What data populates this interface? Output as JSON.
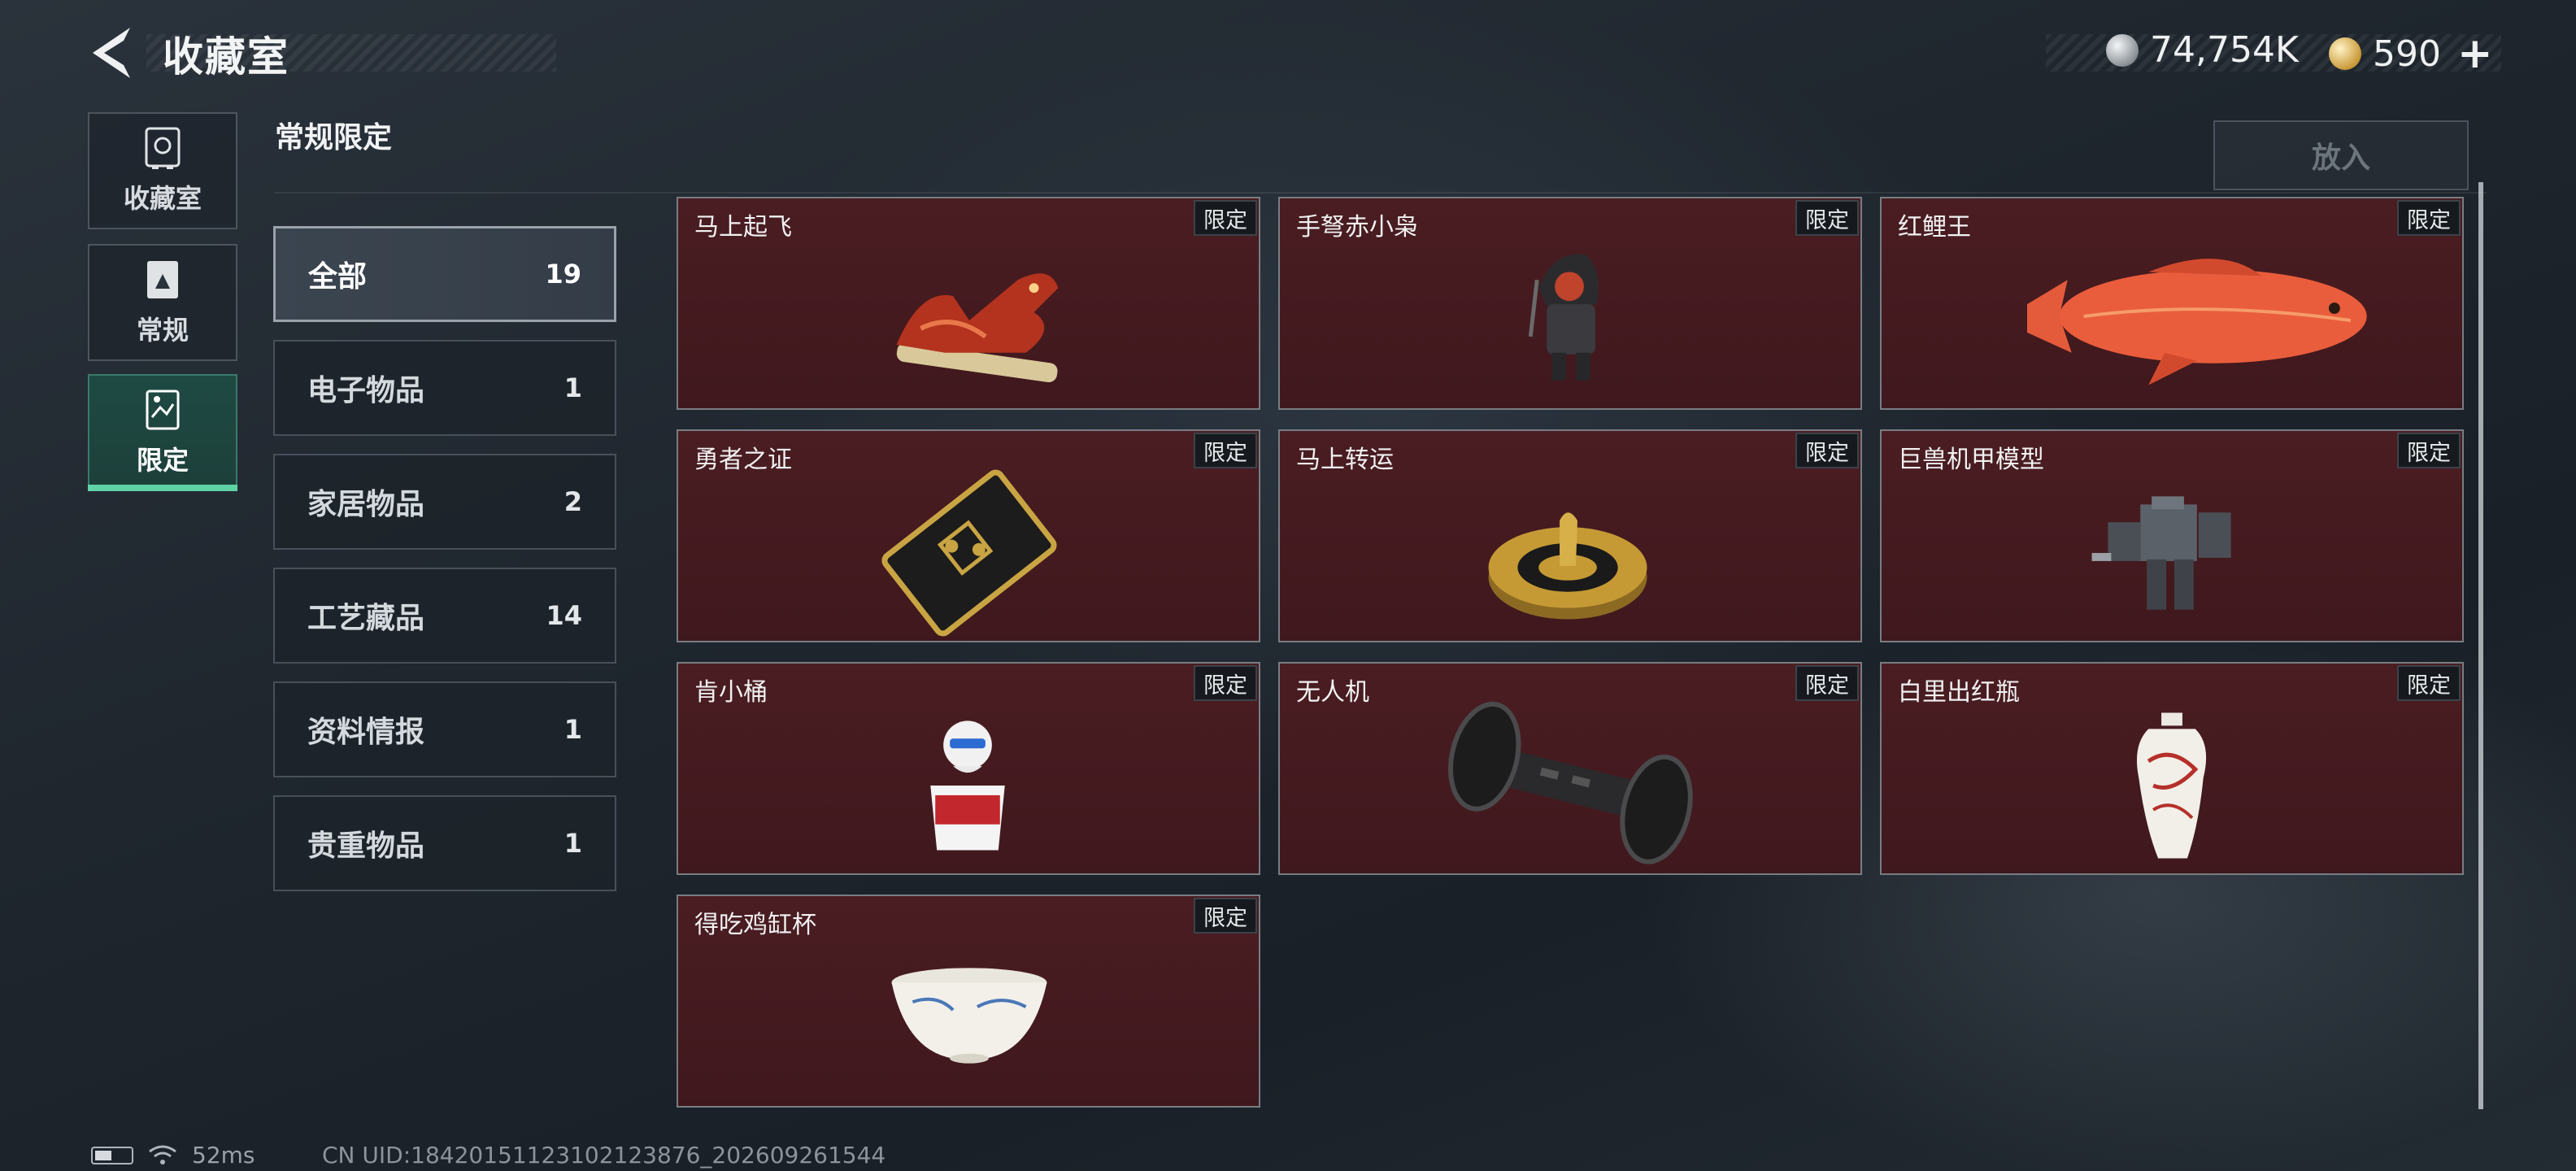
{
  "header": {
    "title": "收藏室",
    "silver_amount": "74,754K",
    "gold_amount": "590"
  },
  "vnav": [
    {
      "label": "收藏室",
      "icon": "vault-icon"
    },
    {
      "label": "常规",
      "icon": "regular-card-icon"
    },
    {
      "label": "限定",
      "icon": "limited-card-icon",
      "active": true
    }
  ],
  "section_title": "常规限定",
  "put_in_label": "放入",
  "categories": [
    {
      "name": "全部",
      "count": "19",
      "active": true
    },
    {
      "name": "电子物品",
      "count": "1"
    },
    {
      "name": "家居物品",
      "count": "2"
    },
    {
      "name": "工艺藏品",
      "count": "14"
    },
    {
      "name": "资料情报",
      "count": "1"
    },
    {
      "name": "贵重物品",
      "count": "1"
    }
  ],
  "items": [
    {
      "name": "马上起飞",
      "tag": "限定",
      "icon": "horse-figurine-icon"
    },
    {
      "name": "手弩赤小枭",
      "tag": "限定",
      "icon": "hooded-figure-icon"
    },
    {
      "name": "红鲤王",
      "tag": "限定",
      "icon": "red-carp-icon"
    },
    {
      "name": "勇者之证",
      "tag": "限定",
      "icon": "card-badge-icon"
    },
    {
      "name": "马上转运",
      "tag": "限定",
      "icon": "golden-spinner-icon"
    },
    {
      "name": "巨兽机甲模型",
      "tag": "限定",
      "icon": "mech-model-icon"
    },
    {
      "name": "肯小桶",
      "tag": "限定",
      "icon": "kfc-bucket-figure-icon"
    },
    {
      "name": "无人机",
      "tag": "限定",
      "icon": "drone-wheels-icon"
    },
    {
      "name": "白里出红瓶",
      "tag": "限定",
      "icon": "porcelain-vase-icon"
    },
    {
      "name": "得吃鸡缸杯",
      "tag": "限定",
      "icon": "porcelain-cup-icon"
    }
  ],
  "status": {
    "latency": "52ms",
    "uid": "CN UID:1842015112310212387​6_202609261544"
  },
  "colors": {
    "accent": "#5fd3a6",
    "card_bg": "#4a1d22",
    "silver": "#a9aeb3",
    "gold": "#c99a3a"
  }
}
